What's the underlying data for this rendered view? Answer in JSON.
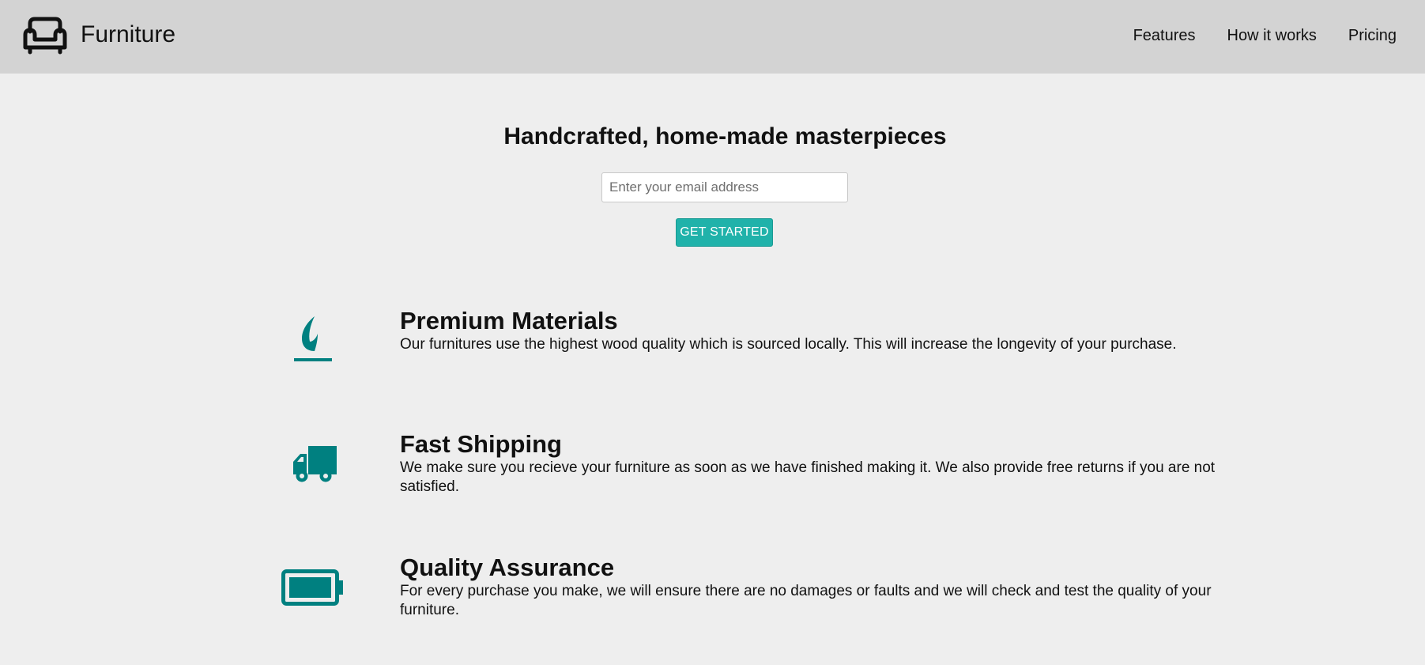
{
  "header": {
    "brand": "Furniture",
    "logo_icon": "sofa-icon",
    "nav": [
      {
        "label": "Features"
      },
      {
        "label": "How it works"
      },
      {
        "label": "Pricing"
      }
    ]
  },
  "hero": {
    "title": "Handcrafted, home-made masterpieces",
    "email_placeholder": "Enter your email address",
    "email_value": "",
    "cta_label": "GET STARTED"
  },
  "features": [
    {
      "icon": "fire-icon",
      "title": "Premium Materials",
      "text": "Our furnitures use the highest wood quality which is sourced locally. This will increase the longevity of your purchase."
    },
    {
      "icon": "truck-icon",
      "title": "Fast Shipping",
      "text": "We make sure you recieve your furniture as soon as we have finished making it. We also provide free returns if you are not satisfied."
    },
    {
      "icon": "battery-full-icon",
      "title": "Quality Assurance",
      "text": "For every purchase you make, we will ensure there are no damages or faults and we will check and test the quality of your furniture."
    }
  ],
  "colors": {
    "header_bg": "#d3d3d3",
    "page_bg": "#eeeeee",
    "accent": "#20b2aa",
    "icon": "#008080"
  }
}
